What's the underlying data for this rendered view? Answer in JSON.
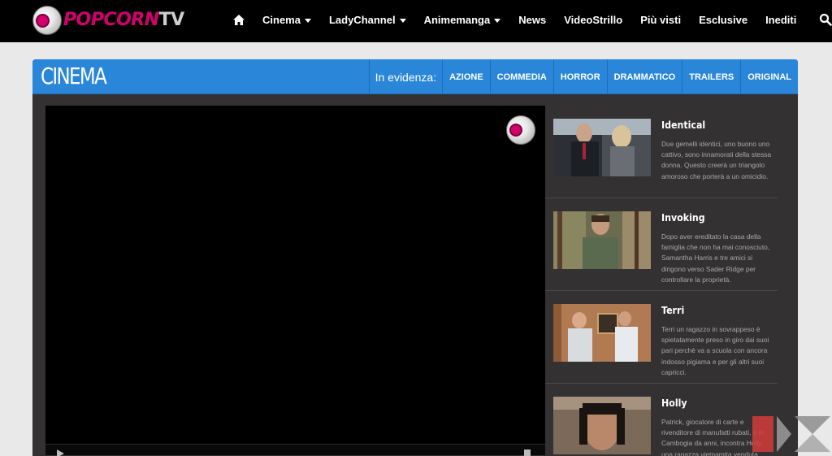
{
  "header": {
    "logo_text_part1": "POPCORN",
    "logo_text_part2": "TV",
    "nav": [
      {
        "label": "Cinema",
        "dropdown": true
      },
      {
        "label": "LadyChannel",
        "dropdown": true
      },
      {
        "label": "Animemanga",
        "dropdown": true
      },
      {
        "label": "News",
        "dropdown": false
      },
      {
        "label": "VideoStrillo",
        "dropdown": false
      },
      {
        "label": "Più visti",
        "dropdown": false
      },
      {
        "label": "Esclusive",
        "dropdown": false
      },
      {
        "label": "Inediti",
        "dropdown": false
      }
    ],
    "home_icon": "home-icon",
    "search_icon": "search-icon"
  },
  "section": {
    "title": "CINEMA",
    "featured_label": "In evidenza:",
    "categories": [
      "AZIONE",
      "COMMEDIA",
      "HORROR",
      "DRAMMATICO",
      "TRAILERS",
      "ORIGINAL"
    ]
  },
  "related": [
    {
      "title": "Identical",
      "description": "Due gemelli identici, uno buono uno cattivo, sono innamorati della stessa donna. Questo creerà un triangolo amoroso che porterà a un omicidio."
    },
    {
      "title": "Invoking",
      "description": "Dopo aver ereditato la casa della famiglia che non ha mai conosciuto, Samantha Harris e tre amici si dirigono verso Sader Ridge per controllare la proprietà."
    },
    {
      "title": "Terri",
      "description": "Terri un ragazzo in sovrappeso è spietatamente preso in giro dai suoi pari perchè va a scuola con ancora indosso pigiama e per gli altri suoi capricci."
    },
    {
      "title": "Holly",
      "description": "Patrick, giocatore di carte e rivenditore di manufatti rubati, è in Cambogia da anni, incontra Holly, una ragazza vietnamita venduta"
    }
  ],
  "colors": {
    "accent_blue": "#2a86d8",
    "brand_pink": "#d4006e",
    "panel_bg": "#333132"
  }
}
